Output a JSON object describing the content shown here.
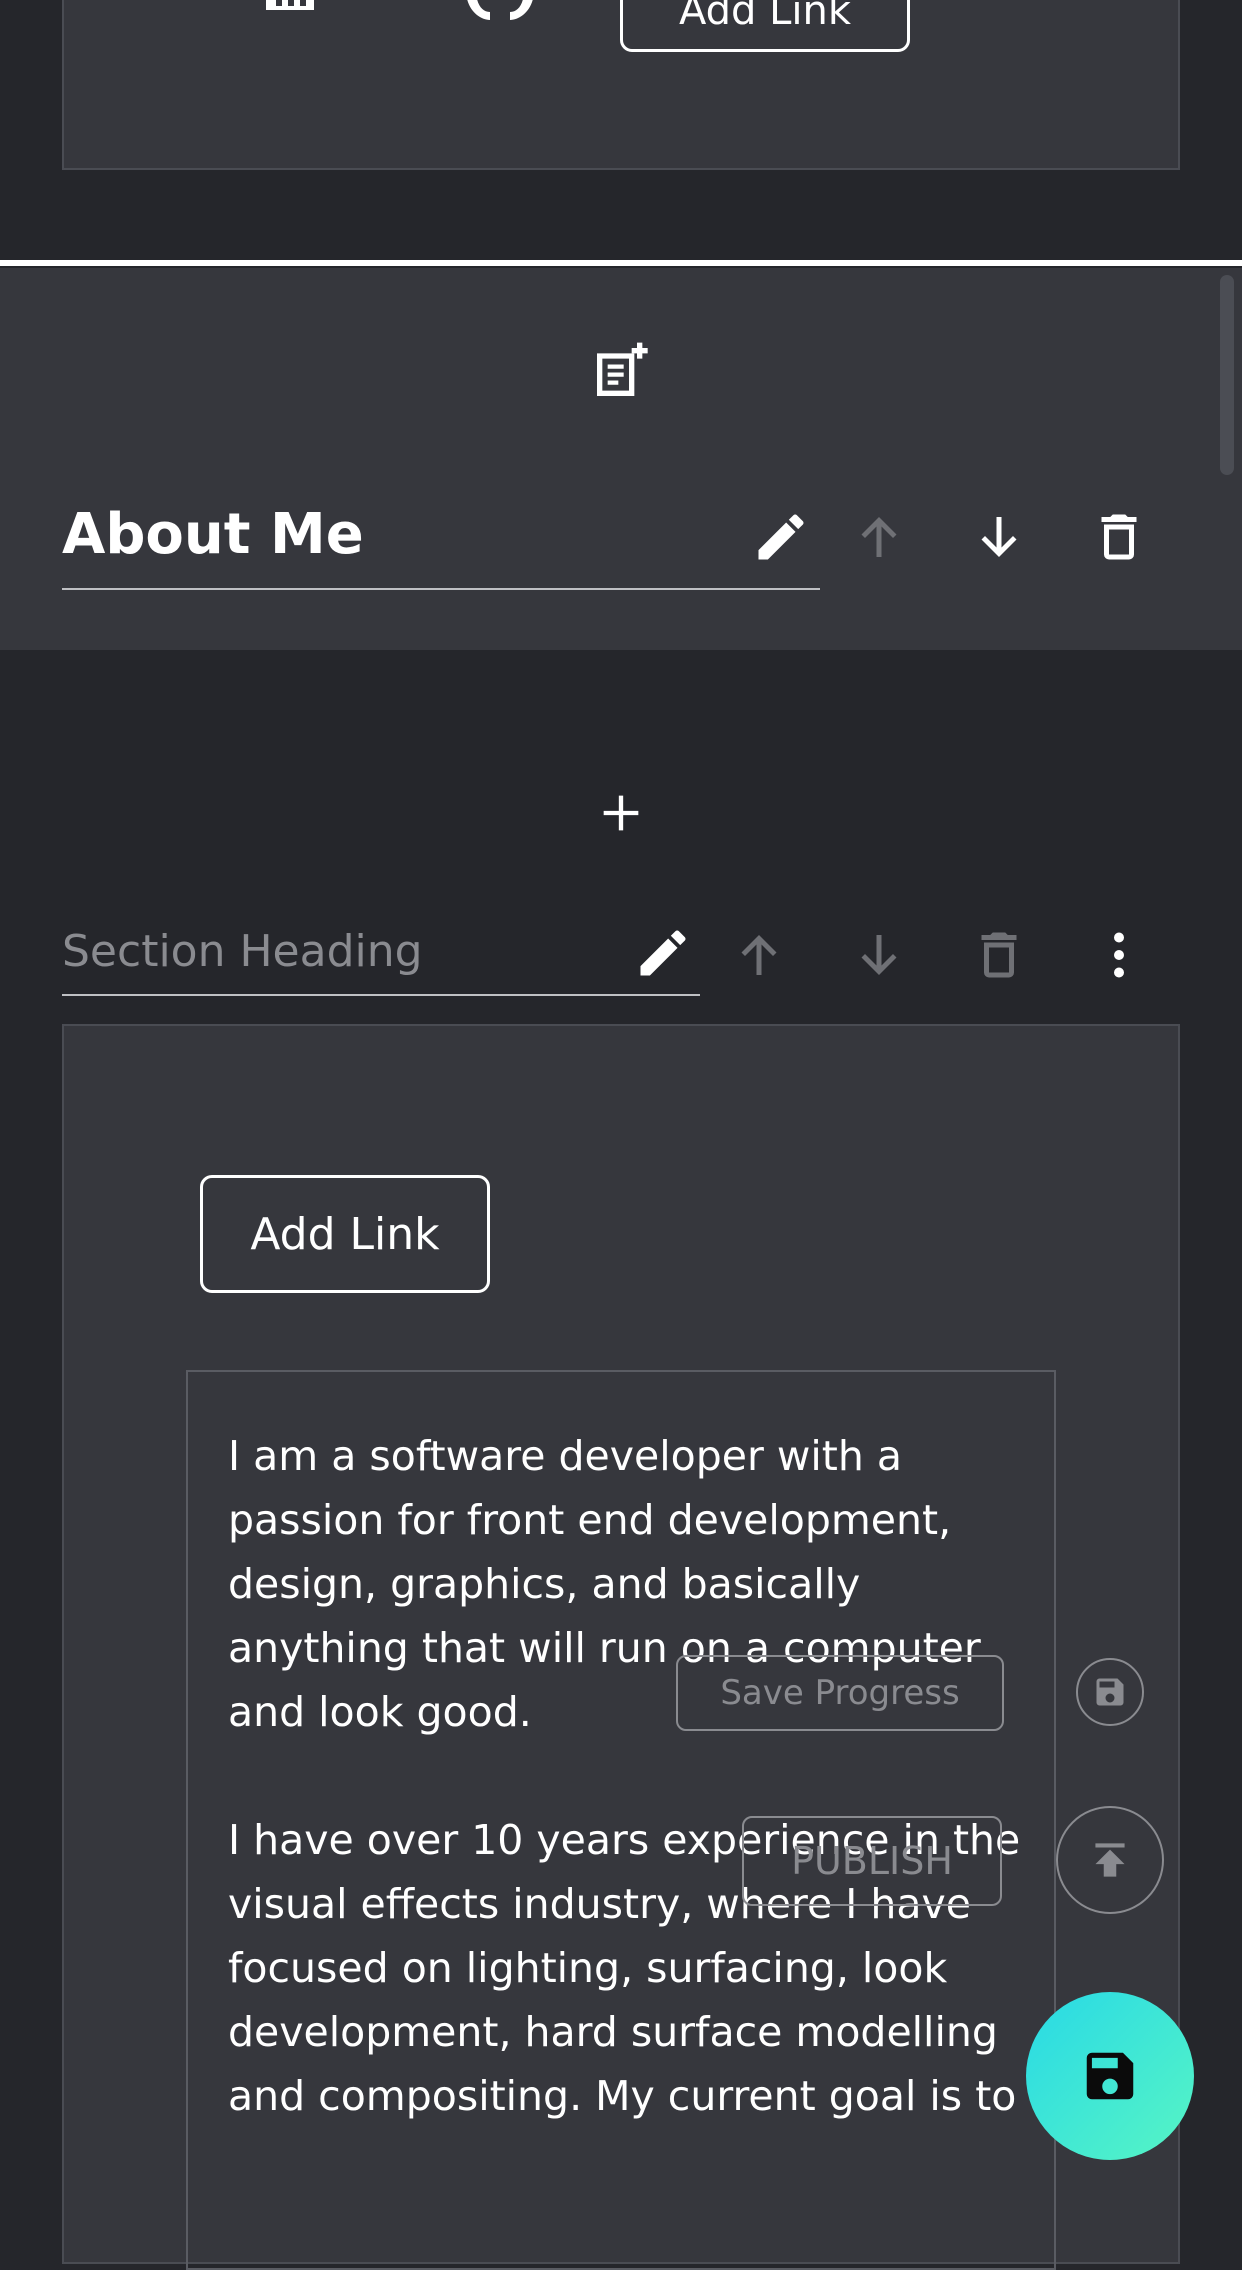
{
  "top_panel": {
    "add_link_label": "Add Link"
  },
  "section1": {
    "heading": "About Me"
  },
  "section2": {
    "heading_placeholder": "Section Heading",
    "add_link_label": "Add Link"
  },
  "about_text": {
    "paragraph1": "I am a software developer with a passion for front end development, design, graphics, and basically anything that will run on a computer and look good.",
    "paragraph2": "I have over 10 years experience in the visual effects industry, where I have focused on lighting, surfacing, look development, hard surface modelling and compositing. My current goal is to"
  },
  "overlay": {
    "save_progress_label": "Save Progress",
    "publish_label": "PUBLISH"
  },
  "colors": {
    "background": "#25262b",
    "panel": "#36373d",
    "fab_gradient_start": "#28d9e6",
    "fab_gradient_end": "#57f5c4"
  },
  "icons": [
    "table-icon",
    "github-icon",
    "note-add-icon",
    "edit-icon",
    "arrow-up-icon",
    "arrow-down-icon",
    "delete-icon",
    "plus-icon",
    "more-vert-icon",
    "save-icon",
    "publish-icon",
    "fab-save-icon"
  ]
}
